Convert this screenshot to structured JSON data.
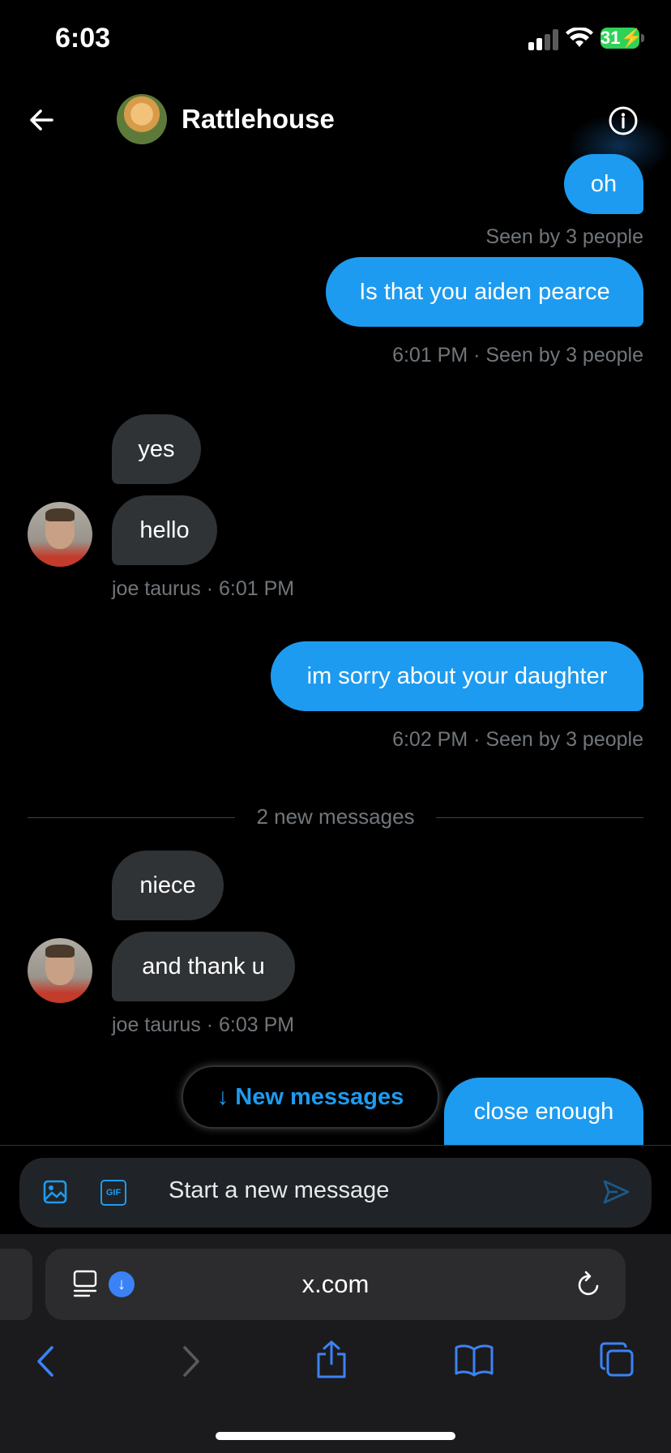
{
  "status": {
    "time": "6:03",
    "battery": "31"
  },
  "header": {
    "title": "Rattlehouse"
  },
  "messages": [
    {
      "text": "oh",
      "meta": "Seen by 3 people"
    },
    {
      "text": "Is that you aiden pearce",
      "meta": "6:01 PM · Seen by 3 people"
    },
    {
      "text": "yes"
    },
    {
      "text": "hello",
      "meta": "joe taurus · 6:01 PM"
    },
    {
      "text": "im sorry about your daughter",
      "meta": "6:02 PM · Seen by 3 people"
    },
    {
      "text": "niece"
    },
    {
      "text": "and thank u",
      "meta": "joe taurus · 6:03 PM"
    },
    {
      "text": "close enough"
    }
  ],
  "divider": {
    "label": "2 new messages"
  },
  "new_messages_button": {
    "label": "↓ New messages"
  },
  "composer": {
    "placeholder": "Start a new message",
    "gif_label": "GIF"
  },
  "browser": {
    "url": "x.com"
  },
  "colors": {
    "accent": "#1d9bf0",
    "incoming_bubble": "#2f3336",
    "background": "#000000"
  }
}
